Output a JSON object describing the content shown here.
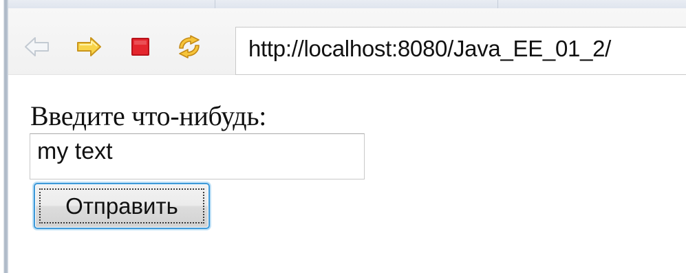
{
  "browser": {
    "toolbar": {
      "back_icon": "back-arrow-icon",
      "forward_icon": "forward-arrow-icon",
      "stop_icon": "stop-icon",
      "refresh_icon": "refresh-icon",
      "colors": {
        "back_disabled": "#d0d6dc",
        "forward": "#f6c52b",
        "stop": "#e0262e",
        "refresh": "#f0b52a"
      }
    },
    "address_bar": {
      "url": "http://localhost:8080/Java_EE_01_2/"
    }
  },
  "page": {
    "prompt_label": "Введите что-нибудь:",
    "text_input": {
      "value": "my text"
    },
    "submit_button": {
      "label": "Отправить"
    }
  }
}
